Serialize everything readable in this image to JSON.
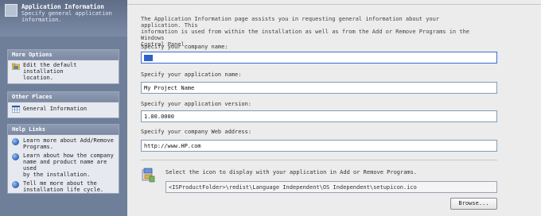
{
  "header": {
    "title": "Application Information",
    "subtitle_line1": "Specify general application",
    "subtitle_line2": "information."
  },
  "sidebar": {
    "more_options": {
      "title": "More Options",
      "items": [
        {
          "label_line1": "Edit the default installation",
          "label_line2": "location."
        }
      ]
    },
    "other_places": {
      "title": "Other Places",
      "items": [
        {
          "label": "General Information"
        }
      ]
    },
    "help_links": {
      "title": "Help Links",
      "items": [
        {
          "lines": [
            "Learn more about Add/Remove",
            "Programs."
          ]
        },
        {
          "lines": [
            "Learn about how the company",
            "name and product name are used",
            "by the installation."
          ]
        },
        {
          "lines": [
            "Tell me more about the",
            "installation life cycle."
          ]
        }
      ]
    }
  },
  "main": {
    "intro_line1": "The Application Information page assists you in requesting general information about your application. This",
    "intro_line2": "information is used from within the installation as well as from the Add or Remove Programs in the Windows",
    "intro_line3": "Control Panel.",
    "company_label": "Specify your company name:",
    "company_value": "",
    "appname_label": "Specify your application name:",
    "appname_value": "My Project Name",
    "version_label": "Specify your application version:",
    "version_value": "1.00.0000",
    "web_label": "Specify your company Web address:",
    "web_value": "http://www.HP.com",
    "icon_label": "Select the icon to display with your application in Add or Remove Programs.",
    "icon_path": "<ISProductFolder>\\redist\\Language Independent\\OS Independent\\setupicon.ico",
    "browse_label": "Browse..."
  },
  "colors": {
    "sidebar_bg": "#6f7f99",
    "section_bg": "#e6e9ef",
    "field_border": "#7f9db9",
    "focus_border": "#3d6ed6"
  }
}
